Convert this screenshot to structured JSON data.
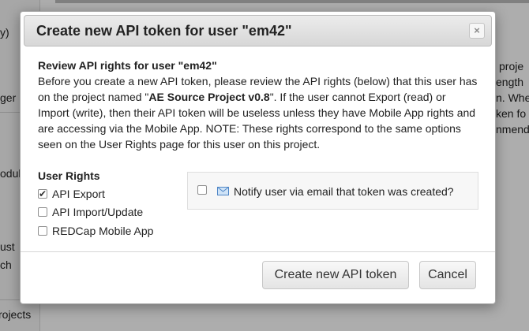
{
  "background": {
    "sidebar_fragments": [
      "y)",
      "ger",
      "odul",
      "ust",
      "ch",
      "rojects"
    ],
    "right_fragments": [
      "proje",
      "ength",
      "n. Whe",
      "ken fo",
      "nmend"
    ]
  },
  "dialog": {
    "title": "Create new API token for user \"em42\"",
    "close_label": "×",
    "review_heading": "Review API rights for user \"em42\"",
    "body_before": "Before you create a new API token, please review the API rights (below) that this user has on the project named \"",
    "project_name": "AE Source Project v0.8",
    "body_after": "\". If the user cannot Export (read) or Import (write), then their API token will be useless unless they have Mobile App rights and are accessing via the Mobile App. NOTE: These rights correspond to the same options seen on the User Rights page for this user on this project.",
    "user_rights_heading": "User Rights",
    "rights": [
      {
        "label": "API Export",
        "checked": true
      },
      {
        "label": "API Import/Update",
        "checked": false
      },
      {
        "label": "REDCap Mobile App",
        "checked": false
      }
    ],
    "notify_label": "Notify user via email that token was created?",
    "create_button": "Create new API token",
    "cancel_button": "Cancel"
  }
}
